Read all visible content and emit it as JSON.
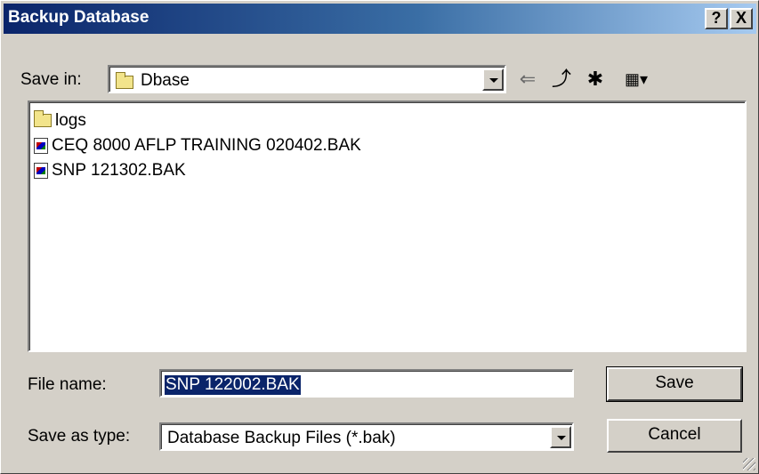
{
  "window": {
    "title": "Backup Database",
    "help_glyph": "?",
    "close_glyph": "X"
  },
  "save_in": {
    "label": "Save in:",
    "value": "Dbase"
  },
  "toolbar": {
    "back_glyph": "⇐",
    "up_glyph": "⤴",
    "new_folder_glyph": "✱",
    "view_glyph": "▦▾"
  },
  "files": [
    {
      "name": "logs",
      "type": "folder"
    },
    {
      "name": "CEQ 8000 AFLP TRAINING 020402.BAK",
      "type": "file"
    },
    {
      "name": "SNP 121302.BAK",
      "type": "file"
    }
  ],
  "file_name": {
    "label": "File name:",
    "value": "SNP 122002.BAK"
  },
  "save_as_type": {
    "label": "Save as type:",
    "value": "Database Backup Files (*.bak)"
  },
  "buttons": {
    "save": "Save",
    "cancel": "Cancel"
  },
  "colors": {
    "titlebar_start": "#0a246a",
    "titlebar_end": "#a6caf0",
    "face": "#d4d0c8",
    "selection": "#0a246a"
  }
}
